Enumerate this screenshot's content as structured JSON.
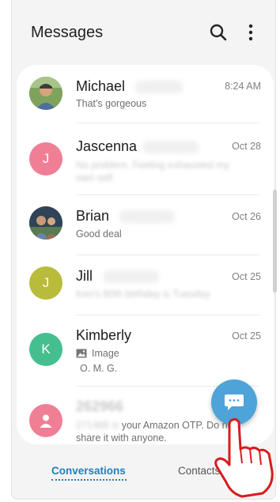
{
  "header": {
    "title": "Messages",
    "search_icon": "search-icon",
    "more_icon": "more-vertical-icon"
  },
  "conversations": [
    {
      "name": "Michael",
      "preview": "That's gorgeous",
      "date": "8:24 AM",
      "avatar_type": "photo"
    },
    {
      "name": "Jascenna",
      "initial": "J",
      "preview_line1": "No problem. Feeling exhausted my",
      "preview_line2": "own self.",
      "date": "Oct 28",
      "avatar_color": "#f07f95"
    },
    {
      "name": "Brian",
      "preview": "Good deal",
      "date": "Oct 26",
      "avatar_type": "photo"
    },
    {
      "name": "Jill",
      "initial": "J",
      "preview": "Ken's 80th birthday is Tuesday",
      "date": "Oct 25",
      "avatar_color": "#b9bb3a"
    },
    {
      "name": "Kimberly",
      "initial": "K",
      "preview_attachment": "Image",
      "preview_line2": "O. M. G.",
      "date": "Oct 25",
      "avatar_color": "#45bf8f"
    },
    {
      "name": "262966",
      "preview_line1_prefix": "271468 is",
      "preview_line1": "your Amazon OTP. Do not",
      "preview_line2": "share it with anyone.",
      "avatar_color": "#f07f95",
      "avatar_icon": "person-icon"
    }
  ],
  "fab": {
    "icon": "compose-chat-icon"
  },
  "tabs": {
    "conversations": "Conversations",
    "contacts": "Contacts"
  },
  "colors": {
    "accent": "#1e7fc0",
    "fab": "#4ea3d8"
  }
}
